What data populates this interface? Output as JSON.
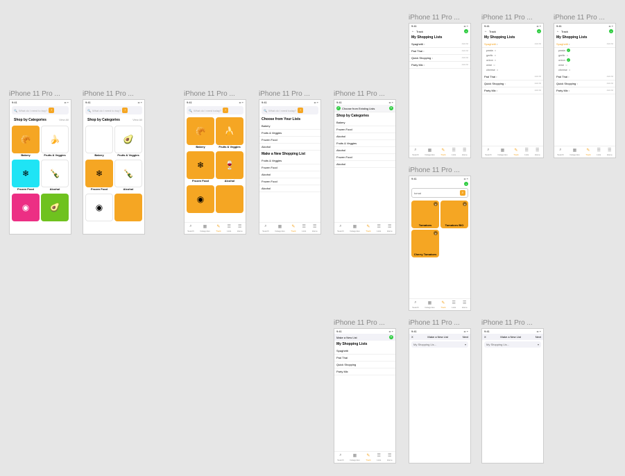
{
  "deviceLabel": "iPhone 11 Pro ...",
  "statusTime": "9:41",
  "searchPlaceholder": "What do I need to buy?",
  "searchPlaceholder2": "What do I need today?",
  "shopByCategories": "Shop by Categories",
  "viewAll": "View All",
  "addAll": "Add All",
  "categories": {
    "bakery": "Bakery",
    "fruitsVeggies": "Fruits & Veggies",
    "frozenFood": "Frozen Food",
    "alcohol": "Alcohol"
  },
  "chooseFromLists": "Choose from Existing Lists",
  "chooseFromYourLists": "Choose from Your Lists",
  "makeNewShoppingList": "Make a New Shopping List",
  "makeNewList": "Make a New List",
  "myShoppingLists": "My Shopping Lists",
  "myShoppingListsDrop": "My Shopping Lis...",
  "track": "Track",
  "tomat": "tomat",
  "next": "Next",
  "x": "X",
  "searchResults": {
    "tomatoes": "Tomatoes",
    "tomatoesBio": "Tomatoes BIO",
    "cherryTomatoes": "Cherry Tomatoes"
  },
  "shoppingLists": {
    "spaghetti": "Spaghetti",
    "padThai": "Pad Thai",
    "quickShopping": "Quick Shopping",
    "partyMix": "Party Mix"
  },
  "spaghettiItems": {
    "pasta": "pasta",
    "garlic": "garlic",
    "onion": "onion",
    "wine": "wine",
    "cheese": "cheese"
  },
  "tabs": {
    "search": "Search",
    "categories": "Categories",
    "track": "Track",
    "lists": "Lists",
    "home": "Home"
  }
}
